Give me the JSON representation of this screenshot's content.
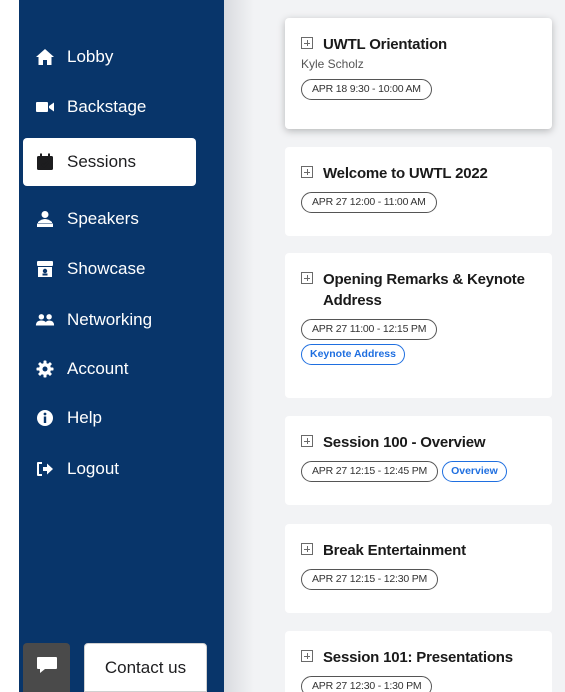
{
  "sidebar": {
    "items": [
      {
        "label": "Lobby",
        "icon": "home-icon"
      },
      {
        "label": "Backstage",
        "icon": "video-camera-icon"
      },
      {
        "label": "Sessions",
        "icon": "calendar-check-icon",
        "active": true
      },
      {
        "label": "Speakers",
        "icon": "presenter-icon"
      },
      {
        "label": "Showcase",
        "icon": "booth-icon"
      },
      {
        "label": "Networking",
        "icon": "users-icon"
      },
      {
        "label": "Account",
        "icon": "gear-icon"
      },
      {
        "label": "Help",
        "icon": "info-icon"
      },
      {
        "label": "Logout",
        "icon": "sign-out-icon"
      }
    ],
    "contact_label": "Contact us"
  },
  "sessions": [
    {
      "title": "UWTL Orientation",
      "speaker": "Kyle Scholz",
      "time": "APR 18 9:30 - 10:00 AM"
    },
    {
      "title": "Welcome to UWTL 2022",
      "time": "APR 27 12:00 - 11:00 AM"
    },
    {
      "title": "Opening Remarks & Keynote Address",
      "time": "APR 27 11:00 - 12:15 PM",
      "tag": "Keynote Address"
    },
    {
      "title": "Session 100 - Overview",
      "time": "APR 27 12:15 - 12:45 PM",
      "tag": "Overview"
    },
    {
      "title": "Break Entertainment",
      "time": "APR 27 12:15 - 12:30 PM"
    },
    {
      "title": "Session 101: Presentations",
      "time": "APR 27 12:30 - 1:30 PM"
    }
  ],
  "colors": {
    "sidebar": "#08356a",
    "accent": "#1f6fe0",
    "background": "#f2f3f5"
  }
}
